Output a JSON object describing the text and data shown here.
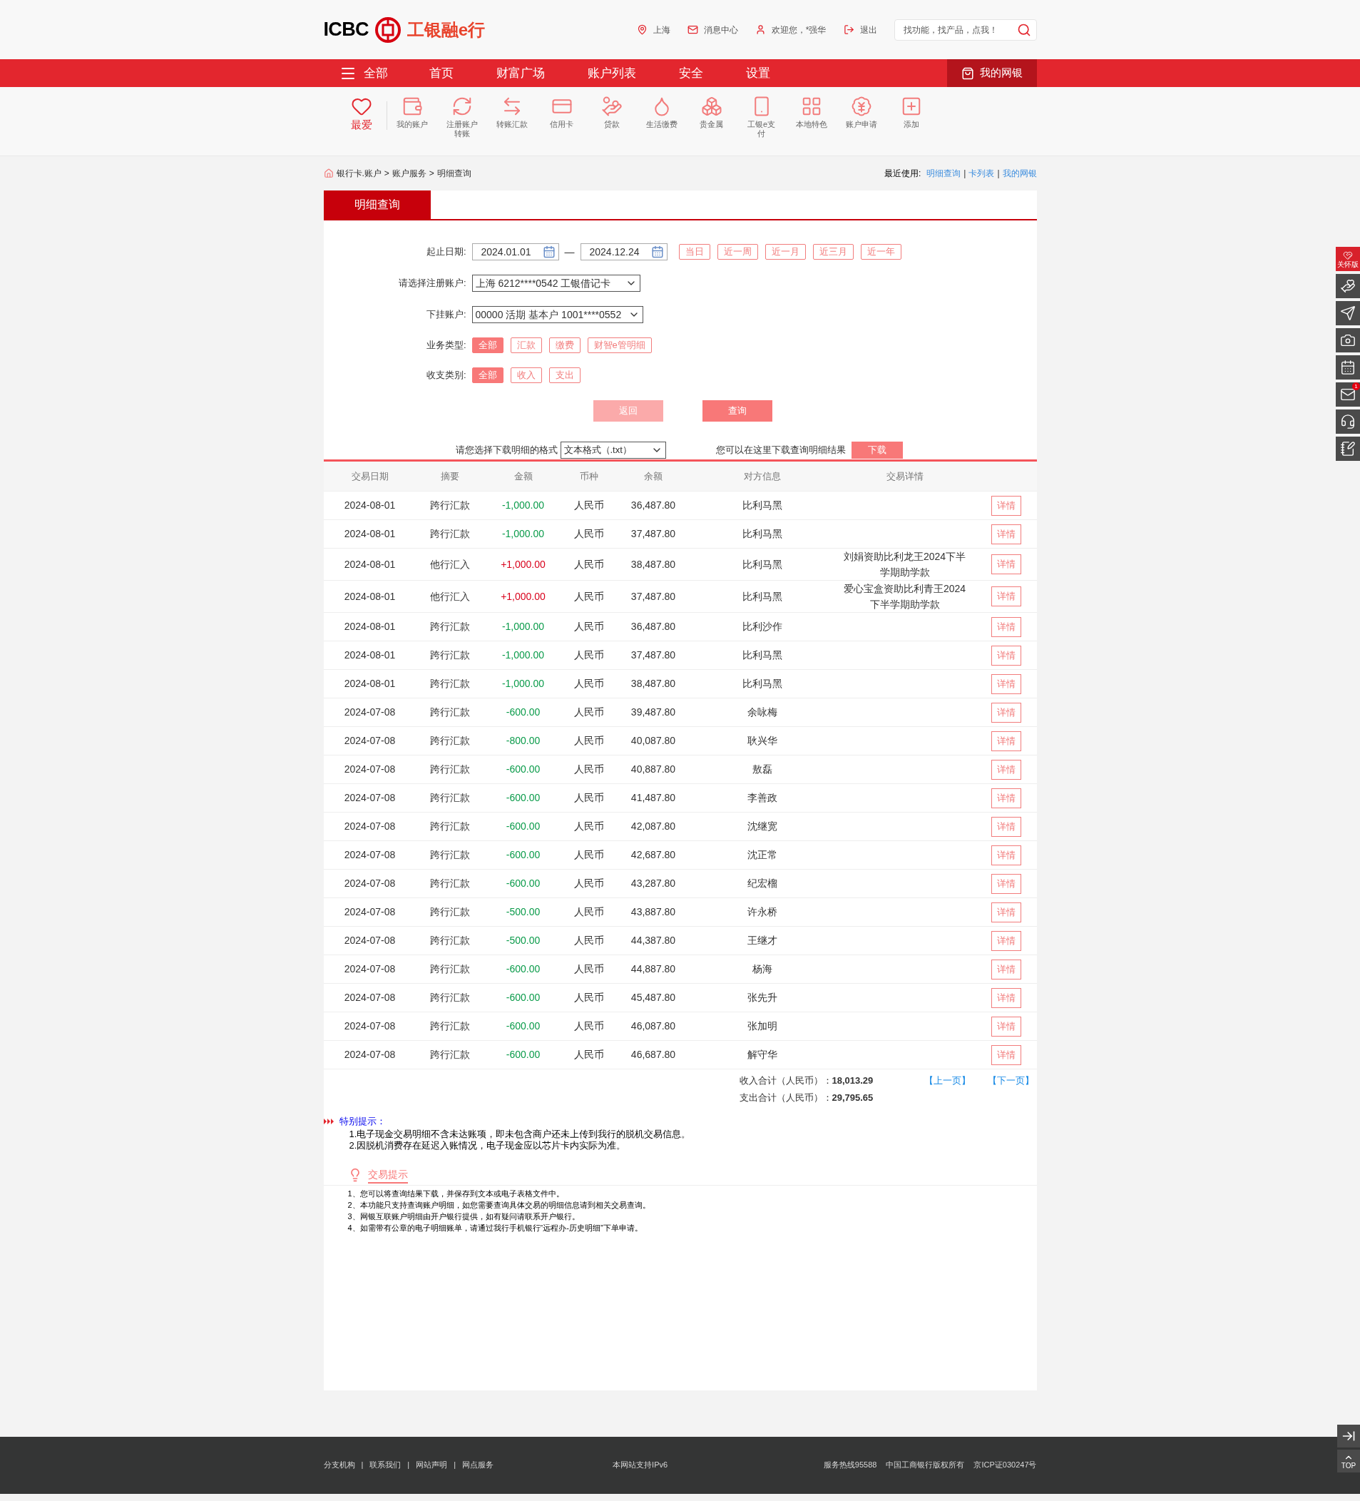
{
  "header": {
    "logo_text": "ICBC",
    "brand": "工银融e行",
    "links": [
      {
        "label": "上海"
      },
      {
        "label": "消息中心"
      },
      {
        "label": "欢迎您，*强华"
      },
      {
        "label": "退出"
      }
    ],
    "search": {
      "placeholder": "找功能，找产品，点我！"
    }
  },
  "nav": {
    "items": [
      {
        "label": "全部"
      },
      {
        "label": "首页"
      },
      {
        "label": "财富广场"
      },
      {
        "label": "账户列表"
      },
      {
        "label": "安全"
      },
      {
        "label": "设置"
      }
    ],
    "my_bank": "我的网银"
  },
  "shortcuts": [
    {
      "label": "最爱",
      "selected": true
    },
    {
      "label": "我的账户",
      "selected": false
    },
    {
      "label": "注册账户转账",
      "selected": false
    },
    {
      "label": "转账汇款",
      "selected": false
    },
    {
      "label": "信用卡",
      "selected": false
    },
    {
      "label": "贷款",
      "selected": false
    },
    {
      "label": "生活缴费",
      "selected": false
    },
    {
      "label": "贵金属",
      "selected": false
    },
    {
      "label": "工银e支付",
      "selected": false
    },
    {
      "label": "本地特色",
      "selected": false
    },
    {
      "label": "账户申请",
      "selected": false
    },
    {
      "label": "添加",
      "selected": false
    }
  ],
  "breadcrumb": {
    "items": [
      "银行卡.账户",
      "账户服务",
      "明细查询"
    ],
    "separator": ">"
  },
  "recent": {
    "label": "最近使用:",
    "links": [
      "明细查询",
      "卡列表",
      "我的网银"
    ],
    "separator": "|"
  },
  "tab": {
    "label": "明细查询"
  },
  "form": {
    "date_label": "起止日期:",
    "start": "2024.01.01",
    "dash": "—",
    "end": "2024.12.24",
    "quick_ranges": [
      {
        "label": "当日",
        "selected": false
      },
      {
        "label": "近一周",
        "selected": false
      },
      {
        "label": "近一月",
        "selected": false
      },
      {
        "label": "近三月",
        "selected": false
      },
      {
        "label": "近一年",
        "selected": false
      }
    ],
    "account_label": "请选择注册账户:",
    "account": "上海 6212****0542 工银借记卡",
    "sub_label": "下挂账户:",
    "sub_account": "00000 活期 基本户 1001****0552",
    "filters": [
      {
        "label": "业务类型:",
        "options": [
          {
            "label": "全部",
            "selected": true
          },
          {
            "label": "汇款",
            "selected": false
          },
          {
            "label": "缴费",
            "selected": false
          },
          {
            "label": "财智e管明细",
            "selected": false
          }
        ]
      },
      {
        "label": "收支类别:",
        "options": [
          {
            "label": "全部",
            "selected": true
          },
          {
            "label": "收入",
            "selected": false
          },
          {
            "label": "支出",
            "selected": false
          }
        ]
      }
    ],
    "back": {
      "label": "返回",
      "disabled": true
    },
    "query": {
      "label": "查询",
      "disabled": false
    }
  },
  "download": {
    "label": "请您选择下载明细的格式",
    "format": "文本格式（.txt）",
    "hint": "您可以在这里下载查询明细结果",
    "button": "下载"
  },
  "table": {
    "columns": [
      "交易日期",
      "摘要",
      "金额",
      "币种",
      "余额",
      "对方信息",
      "交易详情"
    ],
    "rows": [
      {
        "date": "2024-08-01",
        "summary": "跨行汇款",
        "amount": "-1,000.00",
        "kind": "out",
        "currency": "人民币",
        "balance": "36,487.80",
        "counterparty": "比利马黑",
        "action": "详情"
      },
      {
        "date": "2024-08-01",
        "summary": "跨行汇款",
        "amount": "-1,000.00",
        "kind": "out",
        "currency": "人民币",
        "balance": "37,487.80",
        "counterparty": "比利马黑",
        "action": "详情"
      },
      {
        "date": "2024-08-01",
        "summary": "他行汇入",
        "amount": "+1,000.00",
        "kind": "in",
        "currency": "人民币",
        "balance": "38,487.80",
        "counterparty": "比利马黑",
        "detail": "刘娟资助比利龙王2024下半学期助学款",
        "action": "详情"
      },
      {
        "date": "2024-08-01",
        "summary": "他行汇入",
        "amount": "+1,000.00",
        "kind": "in",
        "currency": "人民币",
        "balance": "37,487.80",
        "counterparty": "比利马黑",
        "detail": "爱心宝盒资助比利青王2024下半学期助学款",
        "action": "详情"
      },
      {
        "date": "2024-08-01",
        "summary": "跨行汇款",
        "amount": "-1,000.00",
        "kind": "out",
        "currency": "人民币",
        "balance": "36,487.80",
        "counterparty": "比利沙作",
        "action": "详情"
      },
      {
        "date": "2024-08-01",
        "summary": "跨行汇款",
        "amount": "-1,000.00",
        "kind": "out",
        "currency": "人民币",
        "balance": "37,487.80",
        "counterparty": "比利马黑",
        "action": "详情"
      },
      {
        "date": "2024-08-01",
        "summary": "跨行汇款",
        "amount": "-1,000.00",
        "kind": "out",
        "currency": "人民币",
        "balance": "38,487.80",
        "counterparty": "比利马黑",
        "action": "详情"
      },
      {
        "date": "2024-07-08",
        "summary": "跨行汇款",
        "amount": "-600.00",
        "kind": "out",
        "currency": "人民币",
        "balance": "39,487.80",
        "counterparty": "余咏梅",
        "action": "详情"
      },
      {
        "date": "2024-07-08",
        "summary": "跨行汇款",
        "amount": "-800.00",
        "kind": "out",
        "currency": "人民币",
        "balance": "40,087.80",
        "counterparty": "耿兴华",
        "action": "详情"
      },
      {
        "date": "2024-07-08",
        "summary": "跨行汇款",
        "amount": "-600.00",
        "kind": "out",
        "currency": "人民币",
        "balance": "40,887.80",
        "counterparty": "敖磊",
        "action": "详情"
      },
      {
        "date": "2024-07-08",
        "summary": "跨行汇款",
        "amount": "-600.00",
        "kind": "out",
        "currency": "人民币",
        "balance": "41,487.80",
        "counterparty": "李善政",
        "action": "详情"
      },
      {
        "date": "2024-07-08",
        "summary": "跨行汇款",
        "amount": "-600.00",
        "kind": "out",
        "currency": "人民币",
        "balance": "42,087.80",
        "counterparty": "沈继宽",
        "action": "详情"
      },
      {
        "date": "2024-07-08",
        "summary": "跨行汇款",
        "amount": "-600.00",
        "kind": "out",
        "currency": "人民币",
        "balance": "42,687.80",
        "counterparty": "沈正常",
        "action": "详情"
      },
      {
        "date": "2024-07-08",
        "summary": "跨行汇款",
        "amount": "-600.00",
        "kind": "out",
        "currency": "人民币",
        "balance": "43,287.80",
        "counterparty": "纪宏榴",
        "action": "详情"
      },
      {
        "date": "2024-07-08",
        "summary": "跨行汇款",
        "amount": "-500.00",
        "kind": "out",
        "currency": "人民币",
        "balance": "43,887.80",
        "counterparty": "许永桥",
        "action": "详情"
      },
      {
        "date": "2024-07-08",
        "summary": "跨行汇款",
        "amount": "-500.00",
        "kind": "out",
        "currency": "人民币",
        "balance": "44,387.80",
        "counterparty": "王继才",
        "action": "详情"
      },
      {
        "date": "2024-07-08",
        "summary": "跨行汇款",
        "amount": "-600.00",
        "kind": "out",
        "currency": "人民币",
        "balance": "44,887.80",
        "counterparty": "杨海",
        "action": "详情"
      },
      {
        "date": "2024-07-08",
        "summary": "跨行汇款",
        "amount": "-600.00",
        "kind": "out",
        "currency": "人民币",
        "balance": "45,487.80",
        "counterparty": "张先升",
        "action": "详情"
      },
      {
        "date": "2024-07-08",
        "summary": "跨行汇款",
        "amount": "-600.00",
        "kind": "out",
        "currency": "人民币",
        "balance": "46,087.80",
        "counterparty": "张加明",
        "action": "详情"
      },
      {
        "date": "2024-07-08",
        "summary": "跨行汇款",
        "amount": "-600.00",
        "kind": "out",
        "currency": "人民币",
        "balance": "46,687.80",
        "counterparty": "解守华",
        "action": "详情"
      }
    ]
  },
  "totals": [
    {
      "label": "收入合计（人民币）：",
      "value": "18,013.29"
    },
    {
      "label": "支出合计（人民币）：",
      "value": "29,795.65"
    }
  ],
  "pager": [
    "【上一页】",
    "【下一页】"
  ],
  "notice": {
    "title": "特别提示：",
    "lines": [
      "1.电子现金交易明细不含未达账项，即未包含商户还未上传到我行的脱机交易信息。",
      "2.因脱机消费存在延迟入账情况，电子现金应以芯片卡内实际为准。"
    ]
  },
  "tips": {
    "title": "交易提示",
    "lines": [
      "1、您可以将查询结果下载，并保存到文本或电子表格文件中。",
      "2、本功能只支持查询账户明细，如您需要查询具体交易的明细信息请到相关交易查询。",
      "3、网银互联账户明细由开户银行提供，如有疑问请联系开户银行。",
      "4、如需带有公章的电子明细账单，请通过我行手机银行“远程办-历史明细”下单申请。"
    ]
  },
  "footer": {
    "links": [
      "分支机构",
      "联系我们",
      "网站声明",
      "网点服务"
    ],
    "separator": "|",
    "center": "本网站支持IPv6",
    "right": [
      "服务热线95588",
      "中国工商银行版权所有",
      "京ICP证030247号"
    ]
  },
  "side_tools": [
    {
      "label": "关怀版",
      "selected": true
    },
    {
      "selected": false
    },
    {
      "selected": false
    },
    {
      "selected": false
    },
    {
      "selected": false
    },
    {
      "selected": false,
      "badge": "1"
    },
    {
      "selected": false
    },
    {
      "selected": false
    }
  ],
  "back_to_top": {
    "label": "TOP"
  }
}
